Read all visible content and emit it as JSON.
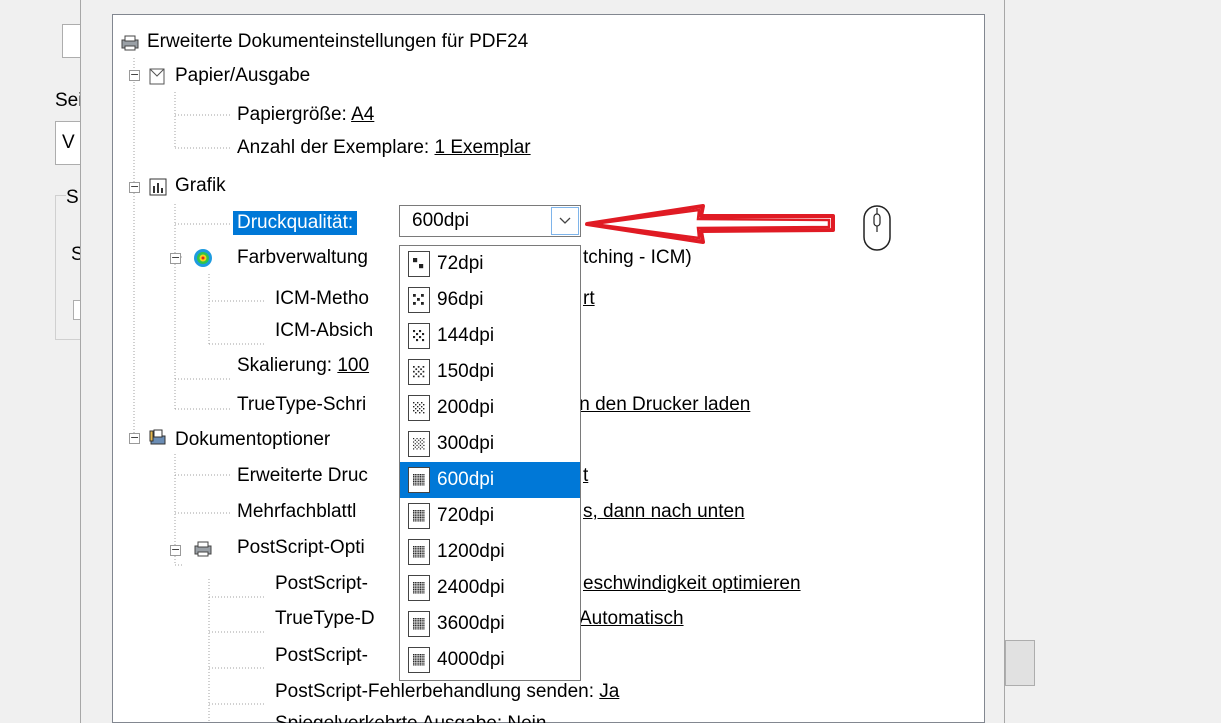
{
  "tree": {
    "root": "Erweiterte Dokumenteinstellungen für PDF24",
    "paper": {
      "label": "Papier/Ausgabe",
      "size_label": "Papiergröße: ",
      "size_value": "A4",
      "copies_label": "Anzahl der Exemplare: ",
      "copies_value": "1 Exemplar"
    },
    "graphics": {
      "label": "Grafik",
      "quality_label": "Druckqualität:",
      "color_label": "Farbverwaltung",
      "color_tail": "tching - ICM)",
      "icm_method": "ICM-Metho",
      "icm_method_tail": "rt",
      "icm_intent": "ICM-Absich",
      "scaling_label": "Skalierung: ",
      "scaling_value": "100",
      "truetype_label": "TrueType-Schri",
      "truetype_tail": "in den Drucker laden"
    },
    "docopts": {
      "label": "Dokumentoptioner",
      "ext_print": "Erweiterte Druc",
      "ext_print_tail": "t",
      "multipage": "Mehrfachblattl",
      "multipage_tail": "s, dann nach unten",
      "ps_options": "PostScript-Opti",
      "ps_out": "PostScript-",
      "ps_out_tail": "eschwindigkeit optimieren",
      "tt_download": "TrueType-D",
      "tt_download_tail": "Automatisch",
      "ps_lang": "PostScript-",
      "ps_error_label": "PostScript-Fehlerbehandlung senden: ",
      "ps_error_value": "Ja",
      "mirror": "Spiegelverkehrte Ausgabe: Nein"
    }
  },
  "left_panel": {
    "seite": "Sei",
    "ve": "V",
    "s1": "S",
    "s2": "S"
  },
  "dropdown": {
    "value": "600dpi",
    "options": [
      "72dpi",
      "96dpi",
      "144dpi",
      "150dpi",
      "200dpi",
      "300dpi",
      "600dpi",
      "720dpi",
      "1200dpi",
      "2400dpi",
      "3600dpi",
      "4000dpi"
    ],
    "selected": "600dpi"
  },
  "colors": {
    "highlight": "#0078d7",
    "arrow": "#e01b24"
  }
}
